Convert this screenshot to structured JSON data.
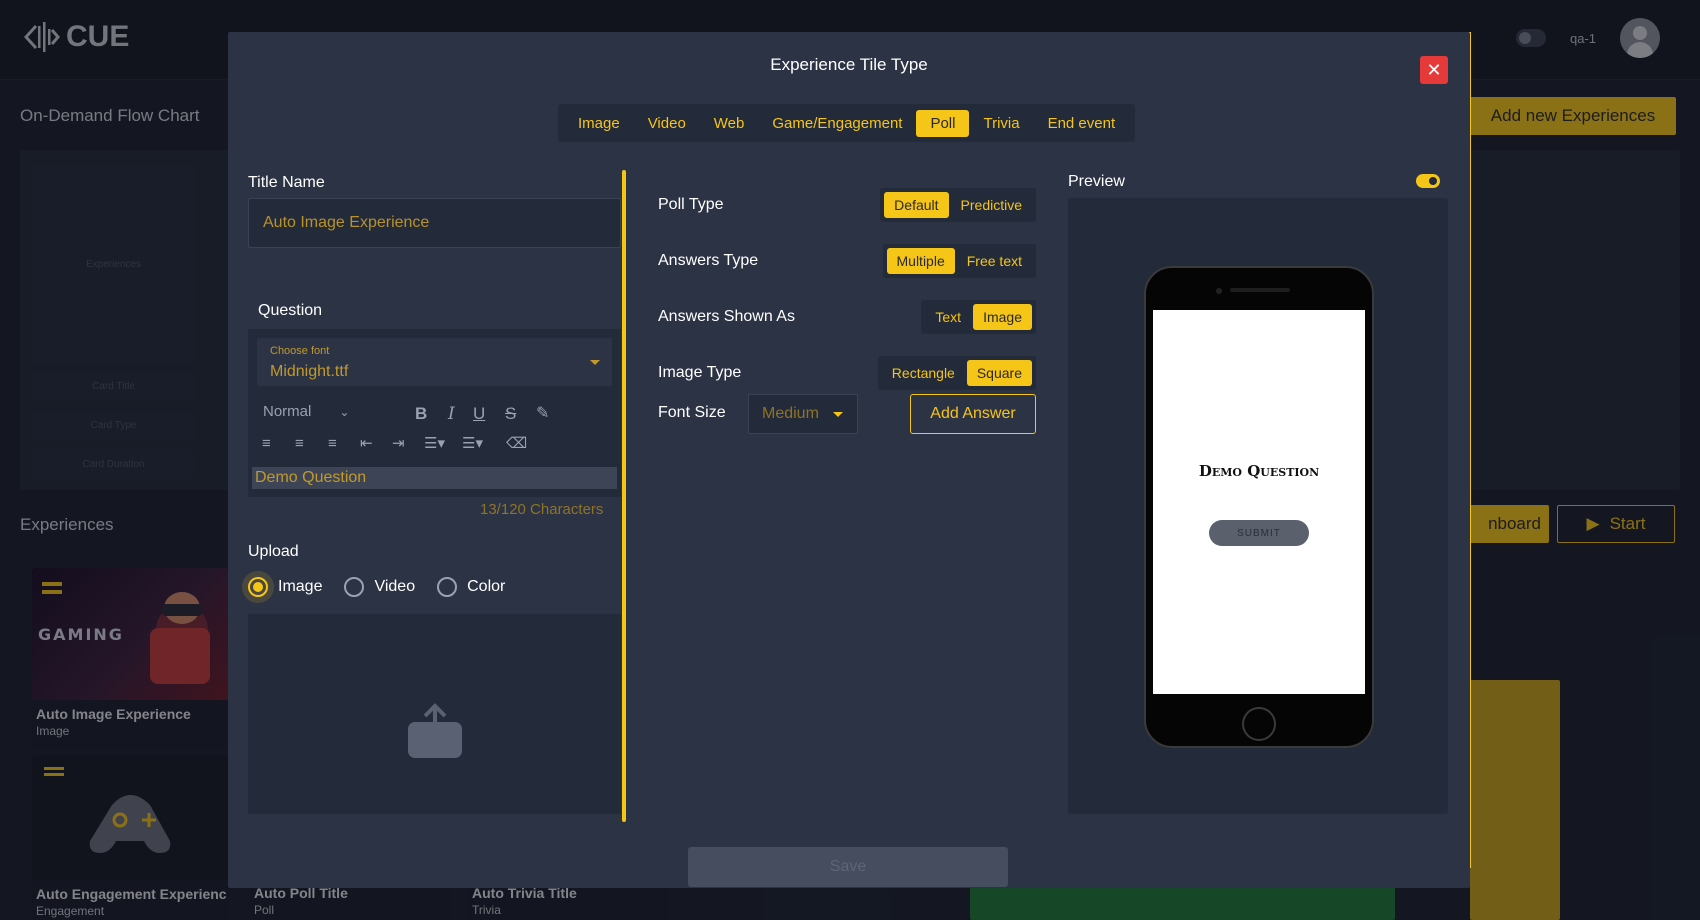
{
  "app": {
    "logo_text": "CUE",
    "user_label": "qa-1"
  },
  "background": {
    "flow_chart_heading": "On-Demand Flow Chart",
    "experiences_heading": "Experiences",
    "add_new_label": "Add new Experiences",
    "onboard_label": "nboard",
    "start_label": "Start",
    "empty_card": {
      "placeholder": "Experiences",
      "fields": [
        "Card Title",
        "Card Type",
        "Card Duration"
      ]
    },
    "experiences": [
      {
        "title": "Auto Image Experience",
        "type": "Image"
      },
      {
        "title": "Auto Engagement Experienc",
        "type": "Engagement"
      },
      {
        "title": "Auto Poll Title",
        "type": "Poll"
      },
      {
        "title": "Auto Trivia Title",
        "type": "Trivia"
      }
    ]
  },
  "modal": {
    "title": "Experience Tile Type",
    "tabs": [
      {
        "label": "Image",
        "active": false
      },
      {
        "label": "Video",
        "active": false
      },
      {
        "label": "Web",
        "active": false
      },
      {
        "label": "Game/Engagement",
        "active": false
      },
      {
        "label": "Poll",
        "active": true
      },
      {
        "label": "Trivia",
        "active": false
      },
      {
        "label": "End event",
        "active": false
      }
    ],
    "title_name_label": "Title Name",
    "title_name_value": "Auto Image Experience",
    "question_label": "Question",
    "font_select": {
      "label": "Choose font",
      "value": "Midnight.ttf"
    },
    "text_style": "Normal",
    "question_text": "Demo Question",
    "char_count": "13/120 Characters",
    "upload_label": "Upload",
    "upload_options": [
      {
        "label": "Image",
        "selected": true
      },
      {
        "label": "Video",
        "selected": false
      },
      {
        "label": "Color",
        "selected": false
      }
    ],
    "poll_type": {
      "label": "Poll Type",
      "options": [
        "Default",
        "Predictive"
      ],
      "selected": "Default"
    },
    "answers_type": {
      "label": "Answers Type",
      "options": [
        "Multiple",
        "Free text"
      ],
      "selected": "Multiple"
    },
    "answers_shown_as": {
      "label": "Answers Shown As",
      "options": [
        "Text",
        "Image"
      ],
      "selected": "Image"
    },
    "image_type": {
      "label": "Image Type",
      "options": [
        "Rectangle",
        "Square"
      ],
      "selected": "Square"
    },
    "font_size": {
      "label": "Font Size",
      "value": "Medium"
    },
    "add_answer_label": "Add Answer",
    "preview_label": "Preview",
    "preview_enabled": true,
    "phone": {
      "question": "Demo Question",
      "submit": "SUBMIT"
    },
    "save_label": "Save"
  },
  "colors": {
    "accent": "#f5c518",
    "modal_bg": "#2c3345",
    "panel_bg": "#232a39",
    "close": "#e63a3a"
  }
}
